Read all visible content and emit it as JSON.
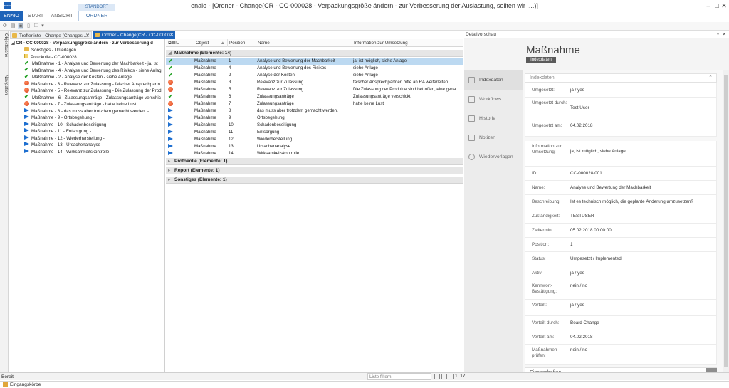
{
  "window": {
    "app_logo": "enaio",
    "title": "enaio  - [Ordner - Change(CR - CC-000028 - Verpackungsgröße ändern - zur Verbesserung der Auslastung, sollten wir ....)]",
    "controls": {
      "minimize": "–",
      "maximize": "□",
      "close": "✕"
    }
  },
  "ribbon": {
    "tabs": [
      "ENAIO",
      "START",
      "ANSICHT"
    ],
    "context_label": "STANDORT",
    "context_tab": "ORDNER"
  },
  "side_tabs": [
    "Objektsuche",
    "Navigation"
  ],
  "doc_tabs": [
    {
      "label": "Trefferliste - Change (Changes ..."
    },
    {
      "label": "Ordner - Change(CR - CC-00000..."
    }
  ],
  "tree": {
    "root": "CR - CC-000028 - Verpackungsgröße ändern - zur Verbesserung d",
    "items": [
      {
        "icon": "folder",
        "label": "Sonstiges - Unterlagen"
      },
      {
        "icon": "doc",
        "label": "Protokolle - CC-000028"
      },
      {
        "icon": "check",
        "label": "Maßnahme - 1 - Analyse und Bewertung der Machbarkeit - ja, ist"
      },
      {
        "icon": "check",
        "label": "Maßnahme - 4 - Analyse und Bewertung des Risikos - siehe Anlag"
      },
      {
        "icon": "check",
        "label": "Maßnahme - 2 - Analyse der Kosten - siehe Anlage"
      },
      {
        "icon": "red",
        "label": "Maßnahme - 3 - Relevanz zur Zulassung - falscher Ansprechpartn"
      },
      {
        "icon": "red",
        "label": "Maßnahme - 5 - Relevanz zur Zulassung - Die Zulassung der Prod"
      },
      {
        "icon": "check",
        "label": "Maßnahme - 6 - Zulassungsanträge - Zulassungsanträge verschic"
      },
      {
        "icon": "red",
        "label": "Maßnahme - 7 - Zulassungsanträge - hatte keine Lust"
      },
      {
        "icon": "play",
        "label": "Maßnahme - 8 - das muss aber trotzdem gemacht werden. -"
      },
      {
        "icon": "play",
        "label": "Maßnahme - 9 - Ortsbegehung -"
      },
      {
        "icon": "play",
        "label": "Maßnahme - 10 - Schadenbeseitigung -"
      },
      {
        "icon": "play",
        "label": "Maßnahme - 11 - Entsorgung -"
      },
      {
        "icon": "play",
        "label": "Maßnahme - 12 - Wiederherstellung -"
      },
      {
        "icon": "play",
        "label": "Maßnahme - 13 - Ursachenanalyse -"
      },
      {
        "icon": "play",
        "label": "Maßnahme - 14 - Wirksamkeitskontrolle -"
      }
    ]
  },
  "grid": {
    "columns": [
      "Objekt",
      "Position",
      "Name",
      "Information zur Umsetzung"
    ],
    "group_main": "Maßnahme (Elemente: 14)",
    "rows": [
      {
        "icon": "check",
        "objekt": "Maßnahme",
        "position": "1",
        "name": "Analyse und Bewertung der Machbarkeit",
        "info": "ja, ist möglich, siehe Anlage",
        "selected": true
      },
      {
        "icon": "check",
        "objekt": "Maßnahme",
        "position": "4",
        "name": "Analyse und Bewertung des Risikos",
        "info": "siehe Anlage"
      },
      {
        "icon": "check",
        "objekt": "Maßnahme",
        "position": "2",
        "name": "Analyse der Kosten",
        "info": "siehe Anlage"
      },
      {
        "icon": "red",
        "objekt": "Maßnahme",
        "position": "3",
        "name": "Relevanz zur Zulassung",
        "info": "falscher Ansprechpartner, bitte an RA weiterleiten"
      },
      {
        "icon": "red",
        "objekt": "Maßnahme",
        "position": "5",
        "name": "Relevanz zur Zulassung",
        "info": "Die Zulassung der Produkte sind betroffen, eine gena..."
      },
      {
        "icon": "check",
        "objekt": "Maßnahme",
        "position": "6",
        "name": "Zulassungsanträge",
        "info": "Zulassungsanträge verschickt"
      },
      {
        "icon": "red",
        "objekt": "Maßnahme",
        "position": "7",
        "name": "Zulassungsanträge",
        "info": "hatte keine Lust"
      },
      {
        "icon": "play",
        "objekt": "Maßnahme",
        "position": "8",
        "name": "das muss aber trotzdem gemacht werden.",
        "info": ""
      },
      {
        "icon": "play",
        "objekt": "Maßnahme",
        "position": "9",
        "name": "Ortsbegehung",
        "info": ""
      },
      {
        "icon": "play",
        "objekt": "Maßnahme",
        "position": "10",
        "name": "Schadenbeseitigung",
        "info": ""
      },
      {
        "icon": "play",
        "objekt": "Maßnahme",
        "position": "11",
        "name": "Entsorgung",
        "info": ""
      },
      {
        "icon": "play",
        "objekt": "Maßnahme",
        "position": "12",
        "name": "Wiederherstellung",
        "info": ""
      },
      {
        "icon": "play",
        "objekt": "Maßnahme",
        "position": "13",
        "name": "Ursachenanalyse",
        "info": ""
      },
      {
        "icon": "play",
        "objekt": "Maßnahme",
        "position": "14",
        "name": "Wirksamkeitskontrolle",
        "info": ""
      }
    ],
    "groups_collapsed": [
      "Protokolle (Elemente: 1)",
      "Report (Elemente: 1)",
      "Sonstiges (Elemente: 1)"
    ]
  },
  "detail": {
    "header": "Detailvorschau",
    "pin": "ᵠ",
    "close": "✕",
    "title": "Maßnahme",
    "badge": "Indexdaten",
    "nav": [
      "Indexdaten",
      "Workflows",
      "Historie",
      "Notizen",
      "Wiedervorlagen"
    ],
    "section": "Indexdaten",
    "fields": [
      {
        "label": "Umgesetzt:",
        "value": "ja / yes"
      },
      {
        "label": "Umgesetzt durch:",
        "value": "Test User"
      },
      {
        "label": "Umgesetzt am:",
        "value": "04.02.2018"
      },
      {
        "label": "Information zur Umsetzung:",
        "value": "ja, ist möglich, siehe Anlage"
      },
      {
        "label": "ID:",
        "value": "CC-000028-001"
      },
      {
        "label": "Name:",
        "value": "Analyse und Bewertung der Machbarkeit"
      },
      {
        "label": "Beschreibung:",
        "value": "Ist es technisch möglich, die geplante Änderung umzusetzen?"
      },
      {
        "label": "Zuständigkeit:",
        "value": "TESTUSER"
      },
      {
        "label": "Zieltermin:",
        "value": "05.02.2018 00:00:00"
      },
      {
        "label": "Position:",
        "value": "1"
      },
      {
        "label": "Status:",
        "value": "Umgesetzt / Implemented"
      },
      {
        "label": "Aktiv:",
        "value": "ja / yes"
      },
      {
        "label": "Kennwort-Bestätigung:",
        "value": "nein / no"
      },
      {
        "label": "Verteilt:",
        "value": "ja / yes"
      },
      {
        "label": "Verteilt durch:",
        "value": "Board Change"
      },
      {
        "label": "Verteilt am:",
        "value": "04.02.2018"
      },
      {
        "label": "Maßnahmen prüfen:",
        "value": "nein / no"
      }
    ],
    "properties": "Eigenschaften"
  },
  "statusbar": {
    "status": "Bereit",
    "filter_placeholder": "Liste filtern",
    "page": "1",
    "count": "17"
  },
  "bottom": {
    "label": "Eingangskörbe"
  }
}
